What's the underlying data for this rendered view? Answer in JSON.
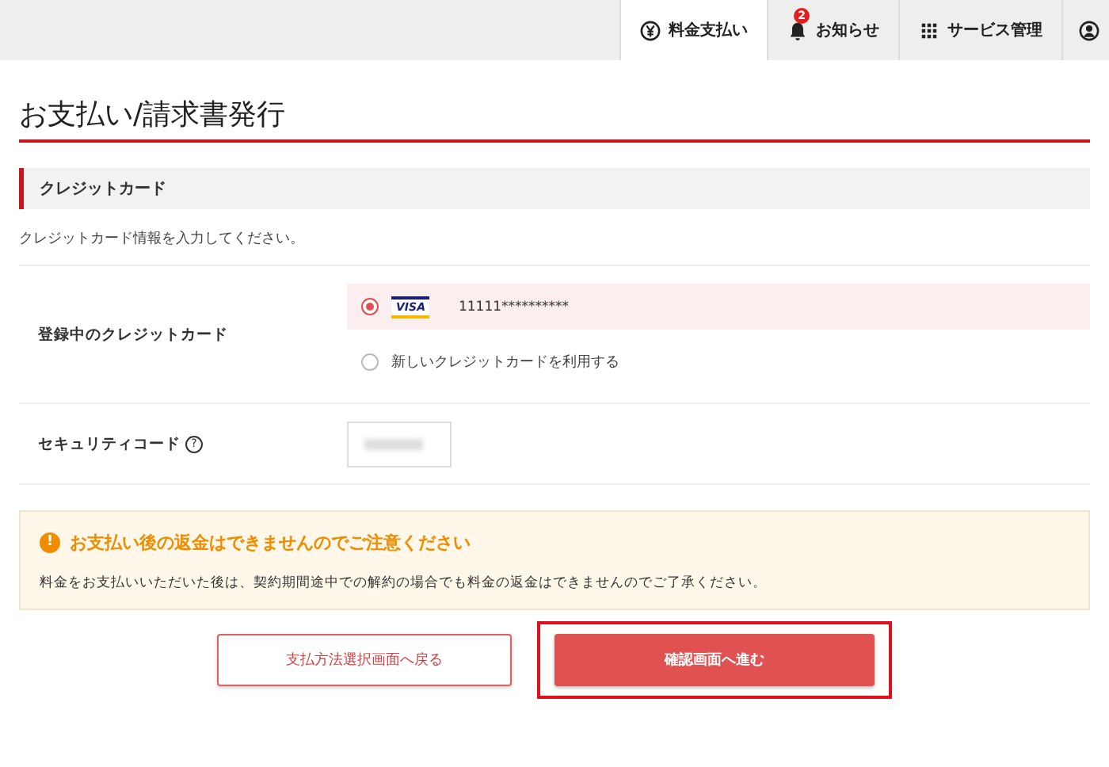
{
  "nav": {
    "tabs": [
      {
        "kind": "yen",
        "label": "料金支払い",
        "selected": true
      },
      {
        "kind": "bell",
        "label": "お知らせ",
        "badge": "2",
        "selected": false
      },
      {
        "kind": "grid",
        "label": "サービス管理",
        "selected": false
      },
      {
        "kind": "user",
        "selected": false
      }
    ]
  },
  "page_title": "お支払い/請求書発行",
  "section_title": "クレジットカード",
  "intro": "クレジットカード情報を入力してください。",
  "card_row": {
    "label": "登録中のクレジットカード",
    "options": [
      {
        "kind": "visa",
        "brand": "VISA",
        "number": "11111**********",
        "selected": true
      },
      {
        "kind": "new",
        "label": "新しいクレジットカードを利用する",
        "selected": false
      }
    ]
  },
  "security_row": {
    "label": "セキュリティコード",
    "help": "?"
  },
  "notice": {
    "icon": "!",
    "title": "お支払い後の返金はできませんのでご注意ください",
    "body": "料金をお支払いいただいた後は、契約期間途中での解約の場合でも料金の返金はできませんのでご了承ください。"
  },
  "buttons": {
    "back": "支払方法選択画面へ戻る",
    "next": "確認画面へ進む",
    "next_highlighted": true
  }
}
